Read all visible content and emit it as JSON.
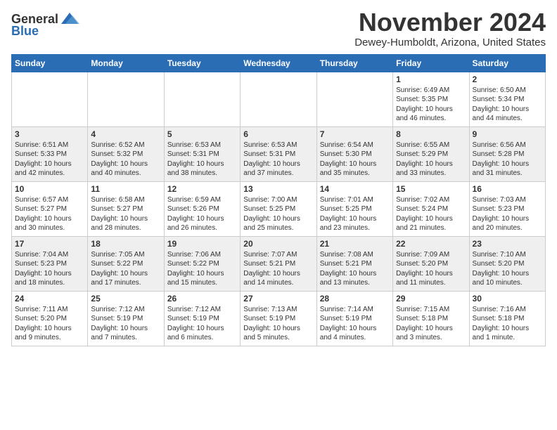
{
  "header": {
    "logo_general": "General",
    "logo_blue": "Blue",
    "month_title": "November 2024",
    "location": "Dewey-Humboldt, Arizona, United States"
  },
  "days_of_week": [
    "Sunday",
    "Monday",
    "Tuesday",
    "Wednesday",
    "Thursday",
    "Friday",
    "Saturday"
  ],
  "weeks": [
    {
      "parity": "odd",
      "days": [
        {
          "num": "",
          "text": "",
          "empty": true
        },
        {
          "num": "",
          "text": "",
          "empty": true
        },
        {
          "num": "",
          "text": "",
          "empty": true
        },
        {
          "num": "",
          "text": "",
          "empty": true
        },
        {
          "num": "",
          "text": "",
          "empty": true
        },
        {
          "num": "1",
          "text": "Sunrise: 6:49 AM\nSunset: 5:35 PM\nDaylight: 10 hours\nand 46 minutes.",
          "empty": false
        },
        {
          "num": "2",
          "text": "Sunrise: 6:50 AM\nSunset: 5:34 PM\nDaylight: 10 hours\nand 44 minutes.",
          "empty": false
        }
      ]
    },
    {
      "parity": "even",
      "days": [
        {
          "num": "3",
          "text": "Sunrise: 6:51 AM\nSunset: 5:33 PM\nDaylight: 10 hours\nand 42 minutes.",
          "empty": false
        },
        {
          "num": "4",
          "text": "Sunrise: 6:52 AM\nSunset: 5:32 PM\nDaylight: 10 hours\nand 40 minutes.",
          "empty": false
        },
        {
          "num": "5",
          "text": "Sunrise: 6:53 AM\nSunset: 5:31 PM\nDaylight: 10 hours\nand 38 minutes.",
          "empty": false
        },
        {
          "num": "6",
          "text": "Sunrise: 6:53 AM\nSunset: 5:31 PM\nDaylight: 10 hours\nand 37 minutes.",
          "empty": false
        },
        {
          "num": "7",
          "text": "Sunrise: 6:54 AM\nSunset: 5:30 PM\nDaylight: 10 hours\nand 35 minutes.",
          "empty": false
        },
        {
          "num": "8",
          "text": "Sunrise: 6:55 AM\nSunset: 5:29 PM\nDaylight: 10 hours\nand 33 minutes.",
          "empty": false
        },
        {
          "num": "9",
          "text": "Sunrise: 6:56 AM\nSunset: 5:28 PM\nDaylight: 10 hours\nand 31 minutes.",
          "empty": false
        }
      ]
    },
    {
      "parity": "odd",
      "days": [
        {
          "num": "10",
          "text": "Sunrise: 6:57 AM\nSunset: 5:27 PM\nDaylight: 10 hours\nand 30 minutes.",
          "empty": false
        },
        {
          "num": "11",
          "text": "Sunrise: 6:58 AM\nSunset: 5:27 PM\nDaylight: 10 hours\nand 28 minutes.",
          "empty": false
        },
        {
          "num": "12",
          "text": "Sunrise: 6:59 AM\nSunset: 5:26 PM\nDaylight: 10 hours\nand 26 minutes.",
          "empty": false
        },
        {
          "num": "13",
          "text": "Sunrise: 7:00 AM\nSunset: 5:25 PM\nDaylight: 10 hours\nand 25 minutes.",
          "empty": false
        },
        {
          "num": "14",
          "text": "Sunrise: 7:01 AM\nSunset: 5:25 PM\nDaylight: 10 hours\nand 23 minutes.",
          "empty": false
        },
        {
          "num": "15",
          "text": "Sunrise: 7:02 AM\nSunset: 5:24 PM\nDaylight: 10 hours\nand 21 minutes.",
          "empty": false
        },
        {
          "num": "16",
          "text": "Sunrise: 7:03 AM\nSunset: 5:23 PM\nDaylight: 10 hours\nand 20 minutes.",
          "empty": false
        }
      ]
    },
    {
      "parity": "even",
      "days": [
        {
          "num": "17",
          "text": "Sunrise: 7:04 AM\nSunset: 5:23 PM\nDaylight: 10 hours\nand 18 minutes.",
          "empty": false
        },
        {
          "num": "18",
          "text": "Sunrise: 7:05 AM\nSunset: 5:22 PM\nDaylight: 10 hours\nand 17 minutes.",
          "empty": false
        },
        {
          "num": "19",
          "text": "Sunrise: 7:06 AM\nSunset: 5:22 PM\nDaylight: 10 hours\nand 15 minutes.",
          "empty": false
        },
        {
          "num": "20",
          "text": "Sunrise: 7:07 AM\nSunset: 5:21 PM\nDaylight: 10 hours\nand 14 minutes.",
          "empty": false
        },
        {
          "num": "21",
          "text": "Sunrise: 7:08 AM\nSunset: 5:21 PM\nDaylight: 10 hours\nand 13 minutes.",
          "empty": false
        },
        {
          "num": "22",
          "text": "Sunrise: 7:09 AM\nSunset: 5:20 PM\nDaylight: 10 hours\nand 11 minutes.",
          "empty": false
        },
        {
          "num": "23",
          "text": "Sunrise: 7:10 AM\nSunset: 5:20 PM\nDaylight: 10 hours\nand 10 minutes.",
          "empty": false
        }
      ]
    },
    {
      "parity": "odd",
      "days": [
        {
          "num": "24",
          "text": "Sunrise: 7:11 AM\nSunset: 5:20 PM\nDaylight: 10 hours\nand 9 minutes.",
          "empty": false
        },
        {
          "num": "25",
          "text": "Sunrise: 7:12 AM\nSunset: 5:19 PM\nDaylight: 10 hours\nand 7 minutes.",
          "empty": false
        },
        {
          "num": "26",
          "text": "Sunrise: 7:12 AM\nSunset: 5:19 PM\nDaylight: 10 hours\nand 6 minutes.",
          "empty": false
        },
        {
          "num": "27",
          "text": "Sunrise: 7:13 AM\nSunset: 5:19 PM\nDaylight: 10 hours\nand 5 minutes.",
          "empty": false
        },
        {
          "num": "28",
          "text": "Sunrise: 7:14 AM\nSunset: 5:19 PM\nDaylight: 10 hours\nand 4 minutes.",
          "empty": false
        },
        {
          "num": "29",
          "text": "Sunrise: 7:15 AM\nSunset: 5:18 PM\nDaylight: 10 hours\nand 3 minutes.",
          "empty": false
        },
        {
          "num": "30",
          "text": "Sunrise: 7:16 AM\nSunset: 5:18 PM\nDaylight: 10 hours\nand 1 minute.",
          "empty": false
        }
      ]
    }
  ]
}
